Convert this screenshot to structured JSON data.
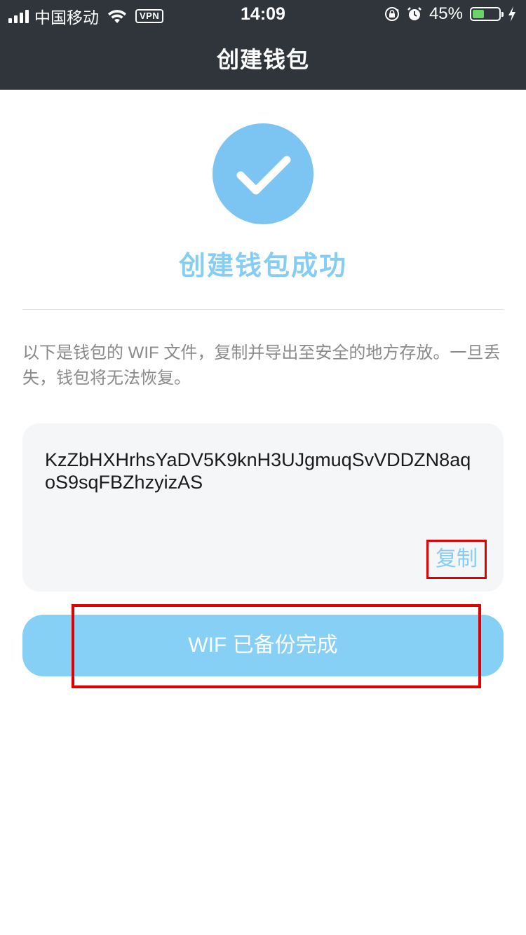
{
  "status_bar": {
    "carrier": "中国移动",
    "vpn": "VPN",
    "time": "14:09",
    "battery_percent_text": "45%",
    "battery_level": 0.45,
    "icons": [
      "signal-icon",
      "wifi-icon",
      "rotation-lock-icon",
      "alarm-icon",
      "battery-icon",
      "charging-icon"
    ]
  },
  "header": {
    "title": "创建钱包"
  },
  "success": {
    "icon": "checkmark-icon",
    "title": "创建钱包成功"
  },
  "notice": {
    "text": "以下是钱包的 WIF 文件，复制并导出至安全的地方存放。一旦丢失，钱包将无法恢复。"
  },
  "wif": {
    "value": "KzZbHXHrhsYaDV5K9knH3UJgmuqSvVDDZN8aqoS9sqFBZhzyizAS",
    "copy_label": "复制"
  },
  "actions": {
    "backup_done_label": "WIF 已备份完成"
  },
  "colors": {
    "header_bg": "#2f353a",
    "accent": "#86cdf4",
    "circle": "#7cc5f2",
    "button_bg": "#86d0f5",
    "highlight": "#e00000",
    "battery_fill": "#6cd26a"
  }
}
